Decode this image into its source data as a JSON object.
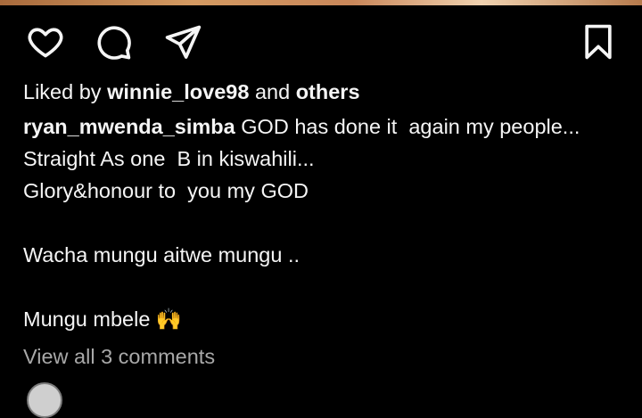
{
  "actions": {
    "like_icon": "heart-outline",
    "comment_icon": "comment-bubble",
    "share_icon": "paper-plane",
    "save_icon": "bookmark-outline"
  },
  "likes": {
    "prefix": "Liked by ",
    "user": "winnie_love98",
    "joiner": " and ",
    "others": "others"
  },
  "caption": {
    "username": "ryan_mwenda_simba",
    "lines": [
      " GOD has done it  again my people...",
      "Straight As one  B in kiswahili...",
      "Glory&honour to  you my GOD",
      "",
      "Wacha mungu aitwe mungu ..",
      "",
      "Mungu mbele 🙌"
    ]
  },
  "comments": {
    "view_all_label": "View all 3 comments"
  },
  "colors": {
    "background": "#000000",
    "text": "#f5f5f5",
    "muted": "#a8a8a8"
  }
}
